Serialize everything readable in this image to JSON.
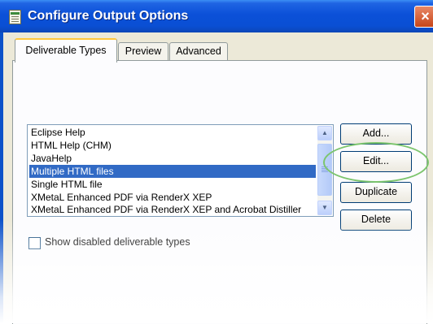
{
  "window": {
    "title": "Configure Output Options",
    "close_glyph": "×"
  },
  "tabs": [
    {
      "label": "Deliverable Types",
      "active": true
    },
    {
      "label": "Preview",
      "active": false
    },
    {
      "label": "Advanced",
      "active": false
    }
  ],
  "deliverables": {
    "items": [
      {
        "label": "Eclipse Help",
        "selected": false
      },
      {
        "label": "HTML Help (CHM)",
        "selected": false
      },
      {
        "label": "JavaHelp",
        "selected": false
      },
      {
        "label": "Multiple HTML files",
        "selected": true
      },
      {
        "label": "Single HTML file",
        "selected": false
      },
      {
        "label": "XMetaL Enhanced PDF via RenderX XEP",
        "selected": false
      },
      {
        "label": "XMetaL Enhanced PDF via RenderX XEP and Acrobat Distiller",
        "selected": false
      }
    ]
  },
  "buttons": {
    "add": "Add...",
    "edit": "Edit...",
    "duplicate": "Duplicate",
    "delete": "Delete"
  },
  "show_disabled": {
    "label": "Show disabled deliverable types",
    "checked": false
  },
  "colors": {
    "titlebar": "#0a4fd4",
    "selection": "#316ac5",
    "highlight_oval": "#7cc56d",
    "tab_active_accent": "#ffc73c"
  },
  "icons": {
    "app": "document-icon",
    "close": "close-icon",
    "scroll_up": "chevron-up-icon",
    "scroll_down": "chevron-down-icon"
  }
}
